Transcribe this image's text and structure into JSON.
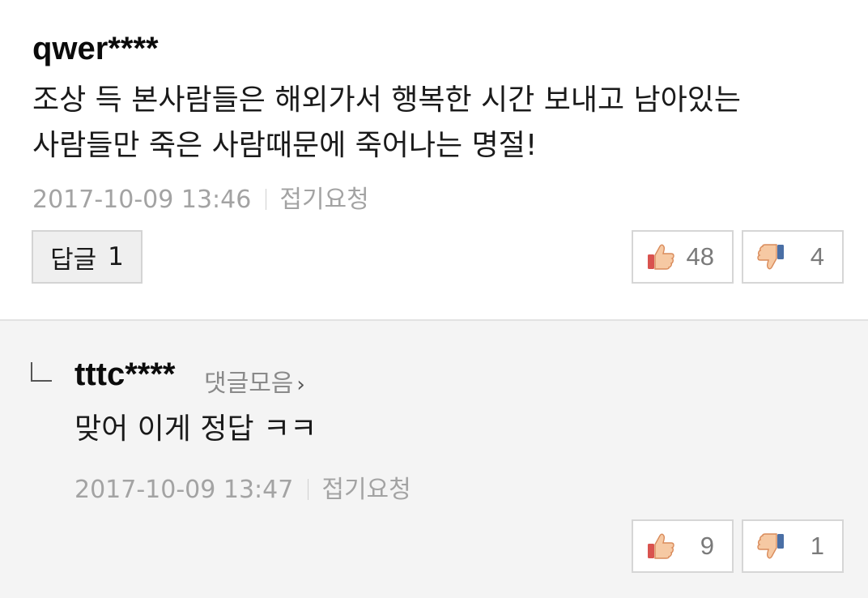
{
  "comments": [
    {
      "author": "qwer****",
      "text_line1": "조상 득 본사람들은 해외가서 행복한 시간 보내고 남아있는",
      "text_line2": "사람들만 죽은 사람때문에 죽어나는 명절!",
      "timestamp": "2017-10-09 13:46",
      "report_label": "접기요청",
      "reply_label": "답글",
      "reply_count": "1",
      "likes": "48",
      "dislikes": "4"
    }
  ],
  "replies": [
    {
      "author": "tttc****",
      "collect_label": "댓글모음",
      "text": "맞어 이게 정답 ㅋㅋ",
      "timestamp": "2017-10-09 13:47",
      "report_label": "접기요청",
      "likes": "9",
      "dislikes": "1"
    }
  ],
  "icons": {
    "like": "thumbs-up-icon",
    "dislike": "thumbs-down-icon",
    "reply_arrow": "reply-indent-icon",
    "chevron": "chevron-right-icon"
  },
  "colors": {
    "like_accent": "#d9534f",
    "dislike_accent": "#4a6fa5",
    "meta_gray": "#a3a3a3"
  }
}
